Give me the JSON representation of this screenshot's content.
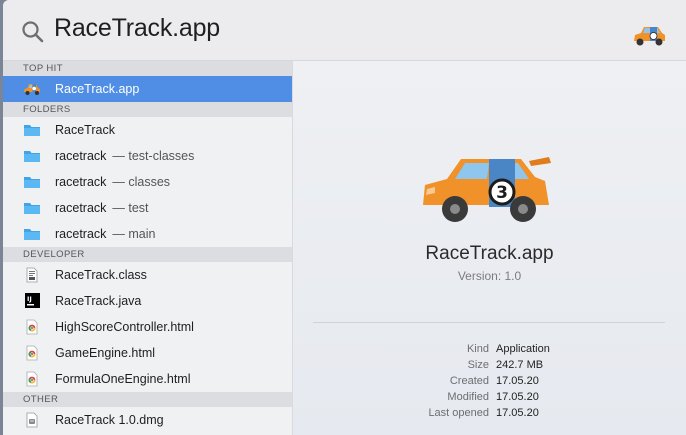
{
  "search": {
    "query": "RaceTrack.app",
    "typed": "Race",
    "completion": "Track.app"
  },
  "sections": {
    "top_hit": "TOP HIT",
    "folders": "FOLDERS",
    "developer": "DEVELOPER",
    "other": "OTHER"
  },
  "top_hit": {
    "label": "RaceTrack.app",
    "icon": "race-car-icon"
  },
  "folders": [
    {
      "label": "RaceTrack",
      "sub": ""
    },
    {
      "label": "racetrack",
      "sub": "— test-classes"
    },
    {
      "label": "racetrack",
      "sub": "— classes"
    },
    {
      "label": "racetrack",
      "sub": "— test"
    },
    {
      "label": "racetrack",
      "sub": "— main"
    }
  ],
  "developer": [
    {
      "label": "RaceTrack.class",
      "icon": "class-file-icon"
    },
    {
      "label": "RaceTrack.java",
      "icon": "intellij-icon"
    },
    {
      "label": "HighScoreController.html",
      "icon": "chrome-html-icon"
    },
    {
      "label": "GameEngine.html",
      "icon": "chrome-html-icon"
    },
    {
      "label": "FormulaOneEngine.html",
      "icon": "chrome-html-icon"
    }
  ],
  "other": [
    {
      "label": "RaceTrack 1.0.dmg",
      "icon": "dmg-icon"
    }
  ],
  "preview": {
    "name": "RaceTrack.app",
    "version": "Version: 1.0",
    "meta": [
      {
        "key": "Kind",
        "value": "Application"
      },
      {
        "key": "Size",
        "value": "242.7 MB"
      },
      {
        "key": "Created",
        "value": "17.05.20"
      },
      {
        "key": "Modified",
        "value": "17.05.20"
      },
      {
        "key": "Last opened",
        "value": "17.05.20"
      }
    ]
  },
  "colors": {
    "selection": "#4f8ee4",
    "car_body": "#f0912a",
    "car_stripe": "#4a86c5"
  }
}
